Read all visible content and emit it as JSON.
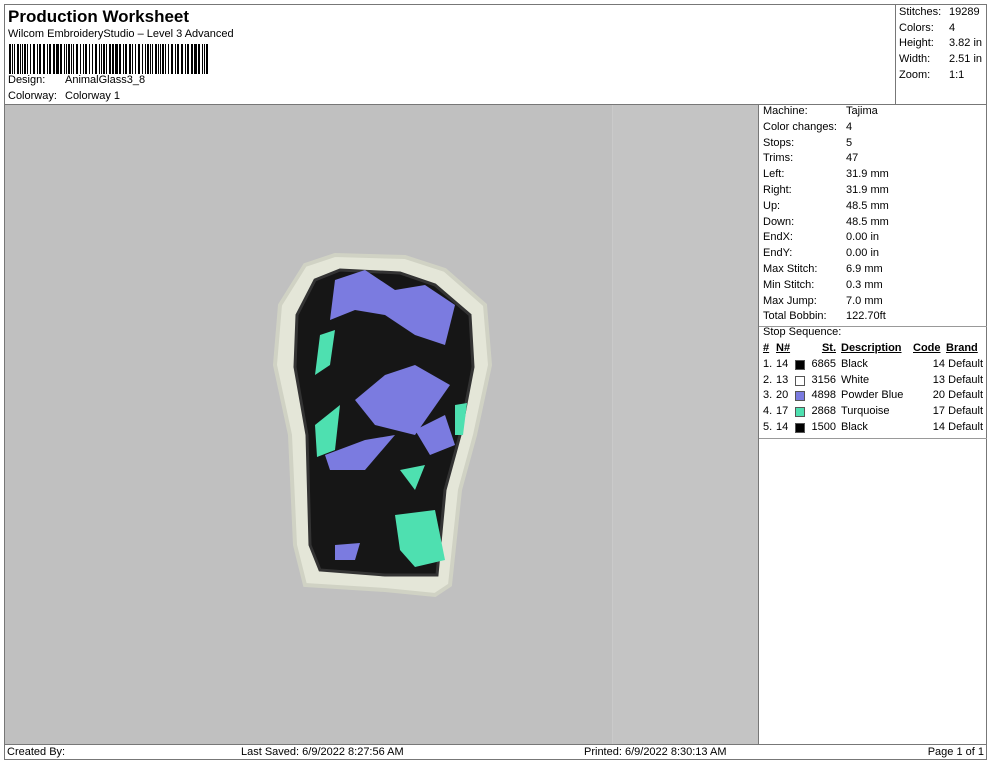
{
  "header": {
    "title": "Production Worksheet",
    "subtitle": "Wilcom EmbroideryStudio – Level 3 Advanced",
    "design_label": "Design:",
    "design_value": "AnimalGlass3_8",
    "colorway_label": "Colorway:",
    "colorway_value": "Colorway 1"
  },
  "stats": [
    {
      "k": "Stitches:",
      "v": "19289"
    },
    {
      "k": "Colors:",
      "v": "4"
    },
    {
      "k": "Height:",
      "v": "3.82 in"
    },
    {
      "k": "Width:",
      "v": "2.51 in"
    },
    {
      "k": "Zoom:",
      "v": "1:1"
    }
  ],
  "machine_info": [
    {
      "k": "Machine:",
      "v": "Tajima"
    },
    {
      "k": "Color changes:",
      "v": "4"
    },
    {
      "k": "Stops:",
      "v": "5"
    },
    {
      "k": "Trims:",
      "v": "47"
    },
    {
      "k": "Left:",
      "v": "31.9 mm"
    },
    {
      "k": "Right:",
      "v": "31.9 mm"
    },
    {
      "k": "Up:",
      "v": "48.5 mm"
    },
    {
      "k": "Down:",
      "v": "48.5 mm"
    },
    {
      "k": "EndX:",
      "v": "0.00 in"
    },
    {
      "k": "EndY:",
      "v": "0.00 in"
    },
    {
      "k": "Max Stitch:",
      "v": "6.9 mm"
    },
    {
      "k": "Min Stitch:",
      "v": "0.3 mm"
    },
    {
      "k": "Max Jump:",
      "v": "7.0 mm"
    },
    {
      "k": "Total Bobbin:",
      "v": "122.70ft"
    }
  ],
  "stop_sequence": {
    "title": "Stop Sequence:",
    "headers": {
      "num": "#",
      "n": "N#",
      "st": "St.",
      "desc": "Description",
      "code": "Code",
      "brand": "Brand"
    },
    "rows": [
      {
        "num": "1.",
        "n": "14",
        "color": "#000000",
        "st": "6865",
        "desc": "Black",
        "code": "14",
        "brand": "Default"
      },
      {
        "num": "2.",
        "n": "13",
        "color": "#ffffff",
        "st": "3156",
        "desc": "White",
        "code": "13",
        "brand": "Default"
      },
      {
        "num": "3.",
        "n": "20",
        "color": "#7b7be0",
        "st": "4898",
        "desc": "Powder Blue",
        "code": "20",
        "brand": "Default"
      },
      {
        "num": "4.",
        "n": "17",
        "color": "#4ee0b0",
        "st": "2868",
        "desc": "Turquoise",
        "code": "17",
        "brand": "Default"
      },
      {
        "num": "5.",
        "n": "14",
        "color": "#000000",
        "st": "1500",
        "desc": "Black",
        "code": "14",
        "brand": "Default"
      }
    ]
  },
  "footer": {
    "created": "Created By:",
    "saved": "Last Saved: 6/9/2022 8:27:56 AM",
    "printed": "Printed: 6/9/2022 8:30:13 AM",
    "page": "Page 1 of 1"
  }
}
